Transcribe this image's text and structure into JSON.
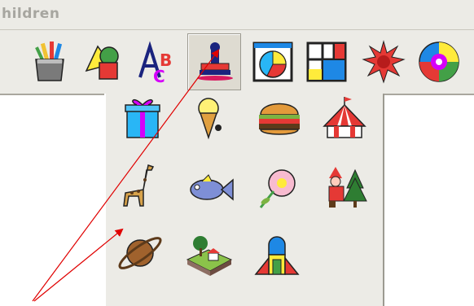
{
  "window": {
    "title_visible": "hildren"
  },
  "toolbar": {
    "tools": [
      {
        "id": "crayon-cup",
        "icon": "crayon-cup-icon",
        "active": false
      },
      {
        "id": "shapes",
        "icon": "shapes-icon",
        "active": false
      },
      {
        "id": "letters",
        "icon": "letters-icon",
        "active": false
      },
      {
        "id": "stamp",
        "icon": "stamp-icon",
        "active": true
      },
      {
        "id": "pie-frame",
        "icon": "pie-chart-frame-icon",
        "active": false
      },
      {
        "id": "mondrian",
        "icon": "mondrian-grid-icon",
        "active": false
      },
      {
        "id": "starburst",
        "icon": "red-starburst-icon",
        "active": false
      },
      {
        "id": "spiral",
        "icon": "color-spiral-icon",
        "active": false
      }
    ]
  },
  "stamp_palette": {
    "stickers": [
      {
        "icon": "gift-box-icon"
      },
      {
        "icon": "ice-cream-cone-icon"
      },
      {
        "icon": "hamburger-icon"
      },
      {
        "icon": "circus-tent-icon"
      },
      {
        "icon": "giraffe-icon"
      },
      {
        "icon": "fish-icon"
      },
      {
        "icon": "flower-icon"
      },
      {
        "icon": "elf-with-tree-icon"
      },
      {
        "icon": "planet-saturn-icon"
      },
      {
        "icon": "island-house-icon"
      },
      {
        "icon": "toy-castle-icon"
      }
    ]
  },
  "annotation": {
    "color": "#e00000"
  }
}
